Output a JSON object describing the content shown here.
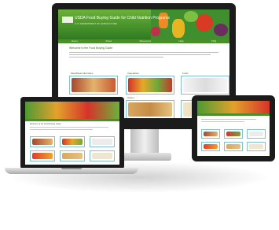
{
  "desktop": {
    "site_title": "USDA Food Buying Guide for Child Nutrition Programs",
    "site_subtitle": "U.S. DEPARTMENT OF AGRICULTURE",
    "nav_items": [
      "Home",
      "About",
      "Resources",
      "Help",
      "FAQ"
    ],
    "welcome": "Welcome to the Food Buying Guide",
    "tiles": [
      "Meat/Meat Alternates",
      "Vegetables",
      "Fruits",
      "Grains",
      "Milk"
    ]
  },
  "laptop": {
    "welcome": "Welcome to the Food Buying Guide"
  },
  "tablet": {}
}
